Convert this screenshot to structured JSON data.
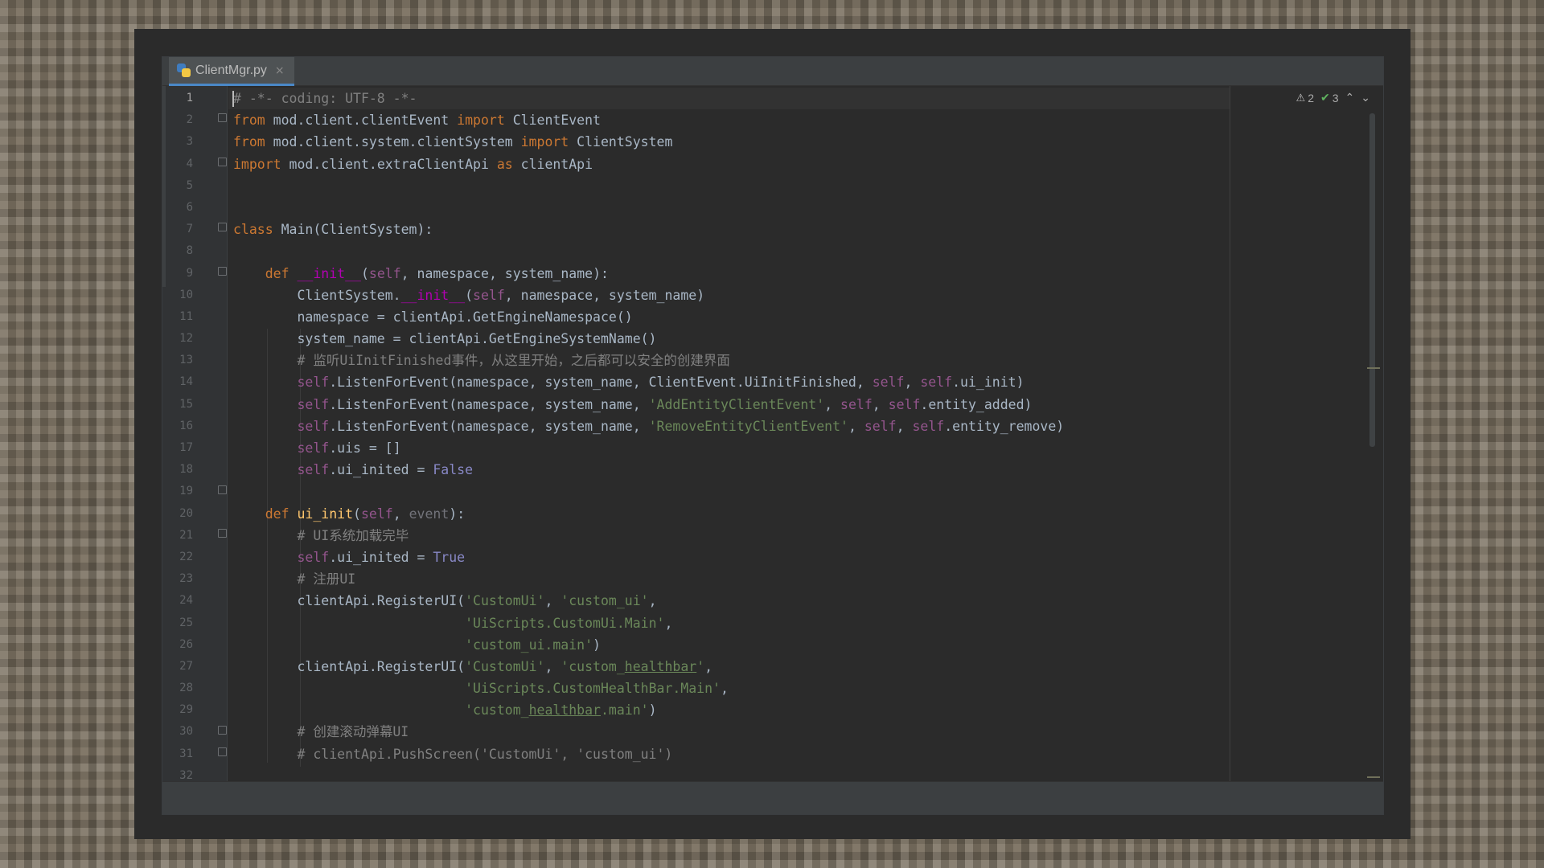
{
  "tab": {
    "filename": "ClientMgr.py",
    "close": "×",
    "icon": "python-file-icon"
  },
  "inspection": {
    "warnings": "2",
    "checks": "3",
    "warn_icon": "warning-icon",
    "check_icon": "check-icon",
    "prev": "^",
    "next": "v"
  },
  "editor": {
    "current_line": 1,
    "line_numbers": [
      "1",
      "2",
      "3",
      "4",
      "5",
      "6",
      "7",
      "8",
      "9",
      "10",
      "11",
      "12",
      "13",
      "14",
      "15",
      "16",
      "17",
      "18",
      "19",
      "20",
      "21",
      "22",
      "23",
      "24",
      "25",
      "26",
      "27",
      "28",
      "29",
      "30",
      "31",
      "32"
    ],
    "lines": [
      [
        {
          "t": "# -*- coding: UTF-8 -*-",
          "c": "cm"
        }
      ],
      [
        {
          "t": "from",
          "c": "kw"
        },
        {
          "t": " mod.client.clientEvent "
        },
        {
          "t": "import",
          "c": "kw"
        },
        {
          "t": " ClientEvent"
        }
      ],
      [
        {
          "t": "from",
          "c": "kw"
        },
        {
          "t": " mod.client.system.clientSystem "
        },
        {
          "t": "import",
          "c": "kw"
        },
        {
          "t": " ClientSystem"
        }
      ],
      [
        {
          "t": "import",
          "c": "kw"
        },
        {
          "t": " mod.client.extraClientApi "
        },
        {
          "t": "as",
          "c": "kw"
        },
        {
          "t": " clientApi"
        }
      ],
      [],
      [],
      [
        {
          "t": "class",
          "c": "kw"
        },
        {
          "t": " Main(ClientSystem):"
        }
      ],
      [],
      [
        {
          "t": "    "
        },
        {
          "t": "def",
          "c": "kw"
        },
        {
          "t": " "
        },
        {
          "t": "__init__",
          "c": "mg"
        },
        {
          "t": "("
        },
        {
          "t": "self",
          "c": "sf"
        },
        {
          "t": ", namespace, system_name):"
        }
      ],
      [
        {
          "t": "        ClientSystem."
        },
        {
          "t": "__init__",
          "c": "mg"
        },
        {
          "t": "("
        },
        {
          "t": "self",
          "c": "sf"
        },
        {
          "t": ", namespace, system_name)"
        }
      ],
      [
        {
          "t": "        namespace = clientApi.GetEngineNamespace()"
        }
      ],
      [
        {
          "t": "        system_name = clientApi.GetEngineSystemName()"
        }
      ],
      [
        {
          "t": "        # 监听UiInitFinished事件，从这里开始，之后都可以安全的创建界面",
          "c": "cm"
        }
      ],
      [
        {
          "t": "        "
        },
        {
          "t": "self",
          "c": "sf"
        },
        {
          "t": ".ListenForEvent(namespace, system_name, ClientEvent.UiInitFinished, "
        },
        {
          "t": "self",
          "c": "sf"
        },
        {
          "t": ", "
        },
        {
          "t": "self",
          "c": "sf"
        },
        {
          "t": ".ui_init)"
        }
      ],
      [
        {
          "t": "        "
        },
        {
          "t": "self",
          "c": "sf"
        },
        {
          "t": ".ListenForEvent(namespace, system_name, "
        },
        {
          "t": "'AddEntityClientEvent'",
          "c": "st"
        },
        {
          "t": ", "
        },
        {
          "t": "self",
          "c": "sf"
        },
        {
          "t": ", "
        },
        {
          "t": "self",
          "c": "sf"
        },
        {
          "t": ".entity_added)"
        }
      ],
      [
        {
          "t": "        "
        },
        {
          "t": "self",
          "c": "sf"
        },
        {
          "t": ".ListenForEvent(namespace, system_name, "
        },
        {
          "t": "'RemoveEntityClientEvent'",
          "c": "st"
        },
        {
          "t": ", "
        },
        {
          "t": "self",
          "c": "sf"
        },
        {
          "t": ", "
        },
        {
          "t": "self",
          "c": "sf"
        },
        {
          "t": ".entity_remove)"
        }
      ],
      [
        {
          "t": "        "
        },
        {
          "t": "self",
          "c": "sf"
        },
        {
          "t": ".uis = []"
        }
      ],
      [
        {
          "t": "        "
        },
        {
          "t": "self",
          "c": "sf"
        },
        {
          "t": ".ui_inited = "
        },
        {
          "t": "False",
          "c": "bi"
        }
      ],
      [],
      [
        {
          "t": "    "
        },
        {
          "t": "def",
          "c": "kw"
        },
        {
          "t": " "
        },
        {
          "t": "ui_init",
          "c": "fn"
        },
        {
          "t": "("
        },
        {
          "t": "self",
          "c": "sf"
        },
        {
          "t": ", "
        },
        {
          "t": "event",
          "c": "pm"
        },
        {
          "t": "):"
        }
      ],
      [
        {
          "t": "        # UI系统加载完毕",
          "c": "cm"
        }
      ],
      [
        {
          "t": "        "
        },
        {
          "t": "self",
          "c": "sf"
        },
        {
          "t": ".ui_inited = "
        },
        {
          "t": "True",
          "c": "bi"
        }
      ],
      [
        {
          "t": "        # 注册UI",
          "c": "cm"
        }
      ],
      [
        {
          "t": "        clientApi.RegisterUI("
        },
        {
          "t": "'CustomUi'",
          "c": "st"
        },
        {
          "t": ", "
        },
        {
          "t": "'custom_ui'",
          "c": "st"
        },
        {
          "t": ","
        }
      ],
      [
        {
          "t": "                             "
        },
        {
          "t": "'UiScripts.CustomUi.Main'",
          "c": "st"
        },
        {
          "t": ","
        }
      ],
      [
        {
          "t": "                             "
        },
        {
          "t": "'custom_ui.main'",
          "c": "st"
        },
        {
          "t": ")"
        }
      ],
      [
        {
          "t": "        clientApi.RegisterUI("
        },
        {
          "t": "'CustomUi'",
          "c": "st"
        },
        {
          "t": ", "
        },
        {
          "t": "'custom_",
          "c": "st"
        },
        {
          "t": "healthbar",
          "c": "st ul"
        },
        {
          "t": "'",
          "c": "st"
        },
        {
          "t": ","
        }
      ],
      [
        {
          "t": "                             "
        },
        {
          "t": "'UiScripts.CustomHealthBar.Main'",
          "c": "st"
        },
        {
          "t": ","
        }
      ],
      [
        {
          "t": "                             "
        },
        {
          "t": "'custom_",
          "c": "st"
        },
        {
          "t": "healthbar",
          "c": "st ul"
        },
        {
          "t": ".main'",
          "c": "st"
        },
        {
          "t": ")"
        }
      ],
      [
        {
          "t": "        # 创建滚动弹幕UI",
          "c": "cm"
        }
      ],
      [
        {
          "t": "        # clientApi.PushScreen('CustomUi', 'custom_ui')",
          "c": "cm"
        }
      ],
      []
    ]
  }
}
